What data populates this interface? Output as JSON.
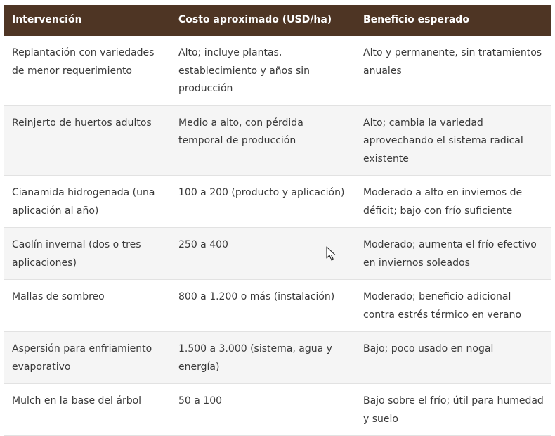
{
  "table": {
    "headers": [
      "Intervención",
      "Costo aproximado (USD/ha)",
      "Beneficio esperado"
    ],
    "rows": [
      [
        "Replantación con variedades de menor requerimiento",
        "Alto; incluye plantas, establecimiento y años sin producción",
        "Alto y permanente, sin tratamientos anuales"
      ],
      [
        "Reinjerto de huertos adultos",
        "Medio a alto, con pérdida temporal de producción",
        "Alto; cambia la variedad aprovechando el sistema radical existente"
      ],
      [
        "Cianamida hidrogenada (una aplicación al año)",
        "100 a 200 (producto y aplicación)",
        "Moderado a alto en inviernos de déficit; bajo con frío suficiente"
      ],
      [
        "Caolín invernal (dos o tres aplicaciones)",
        "250 a 400",
        "Moderado; aumenta el frío efectivo en inviernos soleados"
      ],
      [
        "Mallas de sombreo",
        "800 a 1.200 o más (instalación)",
        "Moderado; beneficio adicional contra estrés térmico en verano"
      ],
      [
        "Aspersión para enfriamiento evaporativo",
        "1.500 a 3.000 (sistema, agua y energía)",
        "Bajo; poco usado en nogal"
      ],
      [
        "Mulch en la base del árbol",
        "50 a 100",
        "Bajo sobre el frío; útil para humedad y suelo"
      ]
    ]
  },
  "colors": {
    "header_bg": "#4e3524",
    "header_text": "#ffffff",
    "stripe": "#f5f5f5"
  },
  "cursor_icon": "arrow-cursor-icon"
}
